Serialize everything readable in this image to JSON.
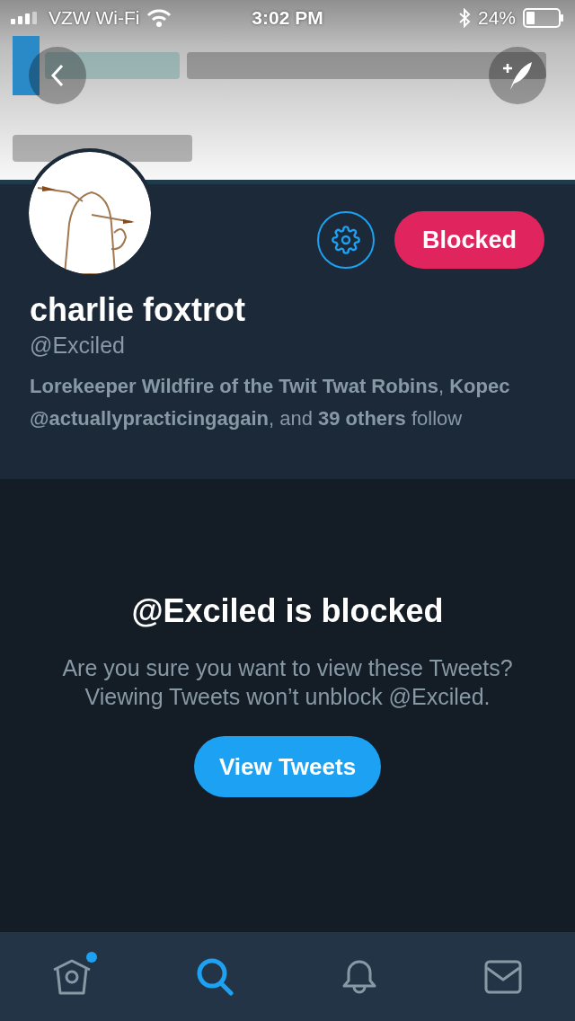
{
  "status_bar": {
    "carrier": "VZW Wi-Fi",
    "time": "3:02 PM",
    "battery": "24%"
  },
  "profile": {
    "action_button": "Blocked",
    "name": "charlie foxtrot",
    "handle": "@Exciled",
    "followers_note": "**Lorekeeper Wildfire of the Twit Twat Robins**, **Kopec @actuallypracticingagain**, and **39 others** follow"
  },
  "blocked_notice": {
    "title": "@Exciled is blocked",
    "message": "Are you sure you want to view these Tweets? Viewing Tweets won’t unblock @Exciled.",
    "button": "View Tweets"
  },
  "tab_bar": [
    {
      "kind": "home",
      "selected": false,
      "badge": true
    },
    {
      "kind": "search",
      "selected": true,
      "badge": false
    },
    {
      "kind": "notifications",
      "selected": false,
      "badge": false
    },
    {
      "kind": "messages",
      "selected": false,
      "badge": false
    }
  ]
}
